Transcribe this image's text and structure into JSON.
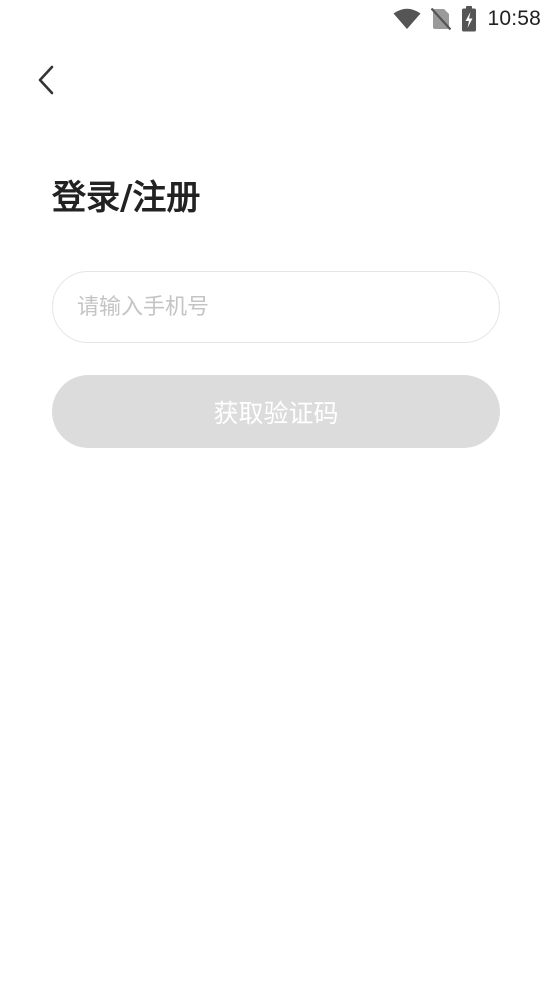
{
  "status_bar": {
    "time": "10:58",
    "icons": [
      "wifi-icon",
      "no-sim-icon",
      "battery-charging-icon"
    ]
  },
  "header": {
    "back_icon": "chevron-left-icon"
  },
  "main": {
    "title": "登录/注册",
    "phone_input": {
      "value": "",
      "placeholder": "请输入手机号"
    },
    "get_code_button": {
      "label": "获取验证码",
      "enabled": false
    }
  },
  "colors": {
    "background": "#ffffff",
    "title_text": "#222222",
    "placeholder_text": "#c4c4c4",
    "input_border": "#e6e6e6",
    "button_disabled_bg": "#dcdcdc",
    "button_text": "#ffffff"
  }
}
